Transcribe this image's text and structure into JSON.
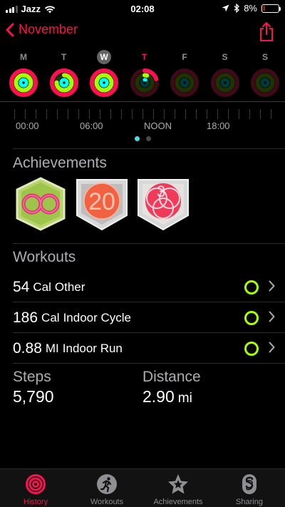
{
  "status": {
    "carrier": "Jazz",
    "time": "02:08",
    "battery": "8%",
    "battery_level": 0.08,
    "signal_bars_filled": 3
  },
  "nav": {
    "back_label": "November"
  },
  "week": [
    {
      "letter": "M",
      "state": "past",
      "move": 1.0,
      "exercise": 1.0,
      "stand": 1.0
    },
    {
      "letter": "T",
      "state": "past",
      "move": 1.0,
      "exercise": 0.75,
      "stand": 1.0
    },
    {
      "letter": "W",
      "state": "selected",
      "move": 1.0,
      "exercise": 1.0,
      "stand": 1.0
    },
    {
      "letter": "T",
      "state": "today",
      "move": 0.2,
      "exercise": 0.05,
      "stand": 0.05
    },
    {
      "letter": "F",
      "state": "future",
      "move": 0,
      "exercise": 0,
      "stand": 0
    },
    {
      "letter": "S",
      "state": "future",
      "move": 0,
      "exercise": 0,
      "stand": 0
    },
    {
      "letter": "S",
      "state": "future",
      "move": 0,
      "exercise": 0,
      "stand": 0
    }
  ],
  "timeline": {
    "labels": [
      "00:00",
      "06:00",
      "NOON",
      "18:00"
    ]
  },
  "achievements": {
    "title": "Achievements"
  },
  "workouts": {
    "title": "Workouts",
    "items": [
      {
        "value": "54",
        "unit": "Cal",
        "name": "Other"
      },
      {
        "value": "186",
        "unit": "Cal",
        "name": "Indoor Cycle"
      },
      {
        "value": "0.88",
        "unit": "MI",
        "name": "Indoor Run"
      }
    ]
  },
  "stats": {
    "steps_label": "Steps",
    "steps_value": "5,790",
    "distance_label": "Distance",
    "distance_value": "2.90",
    "distance_unit": "mi"
  },
  "tabs": [
    {
      "label": "History",
      "icon": "history-rings-icon",
      "active": true
    },
    {
      "label": "Workouts",
      "icon": "running-figure-icon",
      "active": false
    },
    {
      "label": "Achievements",
      "icon": "star-badge-icon",
      "active": false
    },
    {
      "label": "Sharing",
      "icon": "sharing-icon",
      "active": false
    }
  ],
  "colors": {
    "accent": "#fa114f",
    "move": "#fa114f",
    "exercise": "#a6ff00",
    "stand": "#00fff6",
    "workout_ring": "#a6ff00",
    "timeline_dot": "#4fd8e6"
  }
}
